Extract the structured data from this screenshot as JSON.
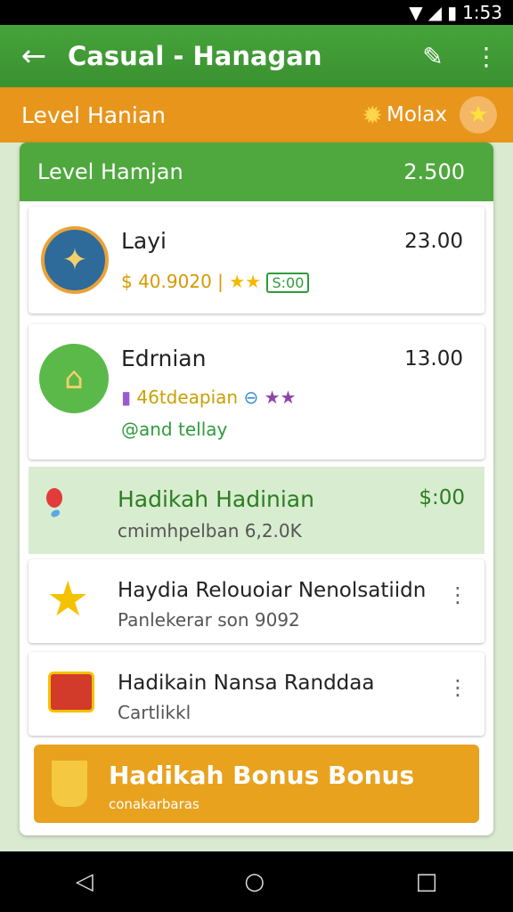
{
  "status": {
    "time": "1:53"
  },
  "app_bar": {
    "title": "Casual - Hanagan",
    "back_icon": "arrow-left-icon",
    "edit_icon": "pencil-icon",
    "menu_icon": "more-vert-icon"
  },
  "level_bar": {
    "label": "Level Hanian",
    "right_label": "Molax",
    "sun_icon": "sun-icon",
    "star_icon": "star-icon"
  },
  "panel": {
    "header_label": "Level Hamjan",
    "header_value": "2.500",
    "cards": [
      {
        "title": "Layi",
        "value": "23.00",
        "line1": "$ 40.9020 |",
        "badge": "S:00",
        "stars": 2
      },
      {
        "title": "Edrnian",
        "value": "13.00",
        "line1": "46tdeapian",
        "line2": "@and tellay",
        "stars": 2
      },
      {
        "title": "Hadikah Hadinian",
        "value": "$:00",
        "subtitle": "cmimhpelban 6,2.0K"
      },
      {
        "title": "Haydia Relouoiar Nenolsatiidn",
        "subtitle": "Panlekerar son 9092"
      },
      {
        "title": "Hadikain Nansa Randdaa",
        "subtitle": "Cartlikkl"
      }
    ],
    "bonus": {
      "title": "Hadikah Bonus Bonus",
      "subtitle": "conakarbaras"
    }
  },
  "colors": {
    "green": "#46a33a",
    "orange": "#e8951c",
    "bonus": "#e8a21e"
  }
}
